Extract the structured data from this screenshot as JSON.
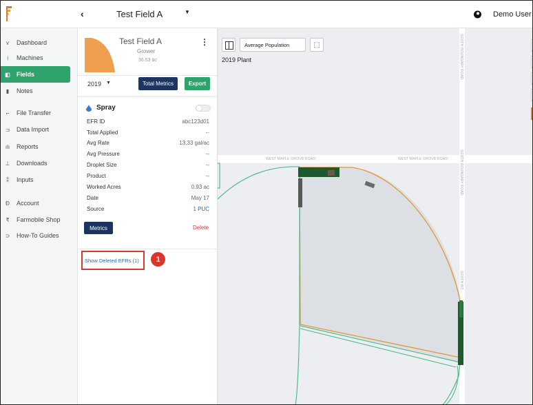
{
  "header": {
    "field_title": "Test Field A",
    "user_name": "Demo User"
  },
  "nav": {
    "items": [
      {
        "label": "Dashboard",
        "icon": "dashboard-icon"
      },
      {
        "label": "Machines",
        "icon": "machines-icon"
      },
      {
        "label": "Fields",
        "icon": "fields-icon",
        "active": true
      },
      {
        "label": "Notes",
        "icon": "notes-icon"
      },
      {
        "label": "File Transfer",
        "icon": "file-transfer-icon"
      },
      {
        "label": "Data Import",
        "icon": "data-import-icon"
      },
      {
        "label": "Reports",
        "icon": "reports-icon"
      },
      {
        "label": "Downloads",
        "icon": "downloads-icon"
      },
      {
        "label": "Inputs",
        "icon": "inputs-icon"
      },
      {
        "label": "Account",
        "icon": "account-icon"
      },
      {
        "label": "Farmobile Shop",
        "icon": "shop-icon"
      },
      {
        "label": "How-To Guides",
        "icon": "guides-icon"
      }
    ]
  },
  "panel": {
    "field_name": "Test Field A",
    "grower": "Grower",
    "acres": "36.53 ac",
    "year": "2019",
    "total_metrics_label": "Total Metrics",
    "export_label": "Export",
    "operation": "Spray",
    "rows": [
      {
        "label": "EFR ID",
        "value": "abc123d01"
      },
      {
        "label": "Total Applied",
        "value": "--"
      },
      {
        "label": "Avg Rate",
        "value": "13.33 gal/ac"
      },
      {
        "label": "Avg Pressure",
        "value": "--"
      },
      {
        "label": "Droplet Size",
        "value": "--"
      },
      {
        "label": "Product",
        "value": "--"
      },
      {
        "label": "Worked Acres",
        "value": "0.93 ac"
      },
      {
        "label": "Date",
        "value": "May 17"
      },
      {
        "label": "Source",
        "value": "1 PUC"
      }
    ],
    "metrics_label": "Metrics",
    "delete_label": "Delete",
    "show_deleted_label": "Show Deleted EFRs (1)",
    "callout_number": "1"
  },
  "map": {
    "layer_select": "Average Population",
    "layer_label": "2019 Plant",
    "roads": {
      "west_maple_1": "WEST MAPLE GROVE ROAD",
      "west_maple_2": "WEST MAPLE GROVE ROAD",
      "south_boundary_1": "SOUTH BOUNDARY ROAD",
      "south_boundary_2": "SOUTH BOUNDARY ROAD",
      "south_boundary_3": "SOUTH BO..."
    },
    "colors": {
      "boundary_orange": "#e6952f",
      "boundary_green": "#4fba8a",
      "coverage_dark_green": "#1e5a2e"
    }
  },
  "colors": {
    "nav_active": "#2ea36b",
    "navy_button": "#1c3560",
    "export_green": "#2ea36b",
    "delete_red": "#d33333",
    "callout_red": "#d9362e"
  }
}
